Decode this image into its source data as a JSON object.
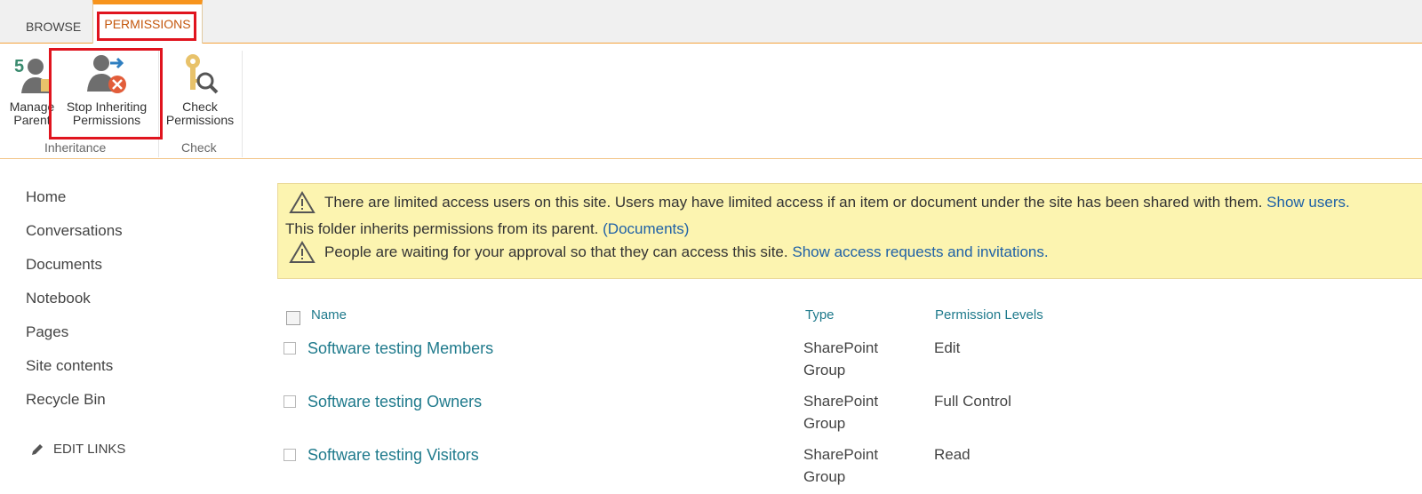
{
  "tabs": {
    "browse": "BROWSE",
    "permissions": "PERMISSIONS"
  },
  "ribbon": {
    "manage_parent_line1": "Manage",
    "manage_parent_line2": "Parent",
    "stop_inheriting_line1": "Stop Inheriting",
    "stop_inheriting_line2": "Permissions",
    "check_line1": "Check",
    "check_line2": "Permissions",
    "group_inheritance": "Inheritance",
    "group_check": "Check"
  },
  "nav": {
    "items": [
      "Home",
      "Conversations",
      "Documents",
      "Notebook",
      "Pages",
      "Site contents",
      "Recycle Bin"
    ],
    "edit_links": "EDIT LINKS"
  },
  "status": {
    "line1_text": "There are limited access users on this site. Users may have limited access if an item or document under the site has been shared with them.",
    "line1_link": "Show users.",
    "line2_text": "This folder inherits permissions from its parent.",
    "line2_link": "(Documents)",
    "line3_text": "People are waiting for your approval so that they can access this site.",
    "line3_link": "Show access requests and invitations."
  },
  "table": {
    "headers": {
      "name": "Name",
      "type": "Type",
      "permission_levels": "Permission Levels"
    },
    "rows": [
      {
        "name": "Software testing Members",
        "type_line1": "SharePoint",
        "type_line2": "Group",
        "permission": "Edit"
      },
      {
        "name": "Software testing Owners",
        "type_line1": "SharePoint",
        "type_line2": "Group",
        "permission": "Full Control"
      },
      {
        "name": "Software testing Visitors",
        "type_line1": "SharePoint",
        "type_line2": "Group",
        "permission": "Read"
      }
    ]
  },
  "colors": {
    "accent_orange": "#f7941d",
    "highlight_red": "#e0141e",
    "link_teal": "#1f7a8c",
    "link_blue": "#1f61a6",
    "status_yellow": "#fcf4b0"
  }
}
